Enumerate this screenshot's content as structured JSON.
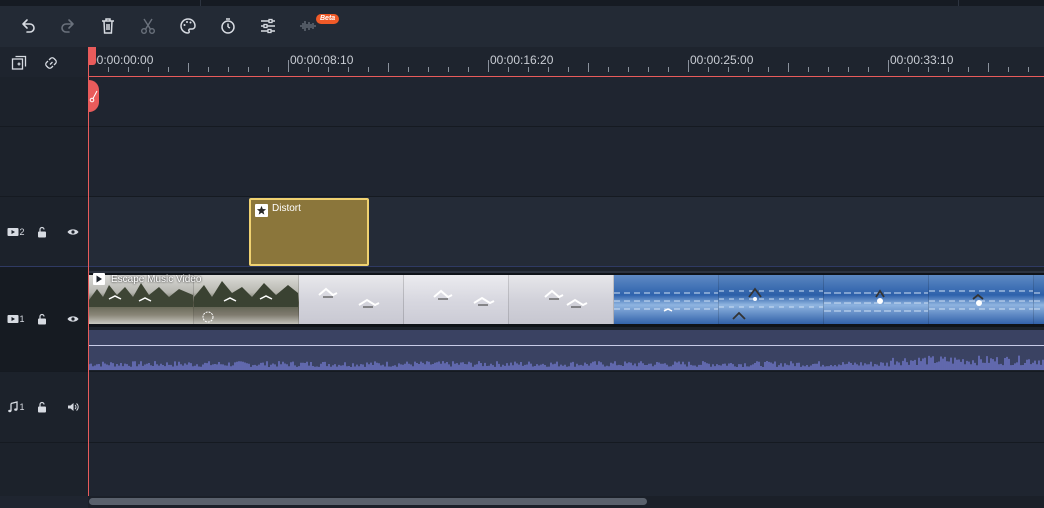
{
  "toolbar": {
    "buttons": [
      {
        "name": "undo-button",
        "icon": "undo-icon"
      },
      {
        "name": "redo-button",
        "icon": "redo-icon"
      },
      {
        "name": "delete-button",
        "icon": "trash-icon"
      },
      {
        "name": "cut-button",
        "icon": "scissors-icon"
      },
      {
        "name": "color-button",
        "icon": "palette-icon"
      },
      {
        "name": "speed-button",
        "icon": "stopwatch-icon"
      },
      {
        "name": "adjust-button",
        "icon": "sliders-icon"
      },
      {
        "name": "audio-button",
        "icon": "waveform-icon"
      }
    ],
    "beta_badge": "Beta"
  },
  "ruler": {
    "timecodes": [
      "00:00:00:00",
      "00:00:08:10",
      "00:00:16:20",
      "00:00:25:00",
      "00:00:33:10"
    ]
  },
  "tracks": {
    "effect_track": {
      "label": "2",
      "icon": "video-track-icon"
    },
    "video_track": {
      "label": "1",
      "icon": "video-track-icon"
    },
    "audio_track": {
      "label": "1",
      "icon": "music-note-icon"
    }
  },
  "clips": {
    "effect": {
      "label": "Distort",
      "icon": "star-icon"
    },
    "video": {
      "label": "Escape Music Video",
      "icon": "play-icon"
    }
  },
  "colors": {
    "playhead": "#e85b5b",
    "effect_clip": "#8b763b",
    "effect_border": "#f0d271",
    "audio_wave": "#6b72c0",
    "beta_badge": "#f05a28"
  }
}
